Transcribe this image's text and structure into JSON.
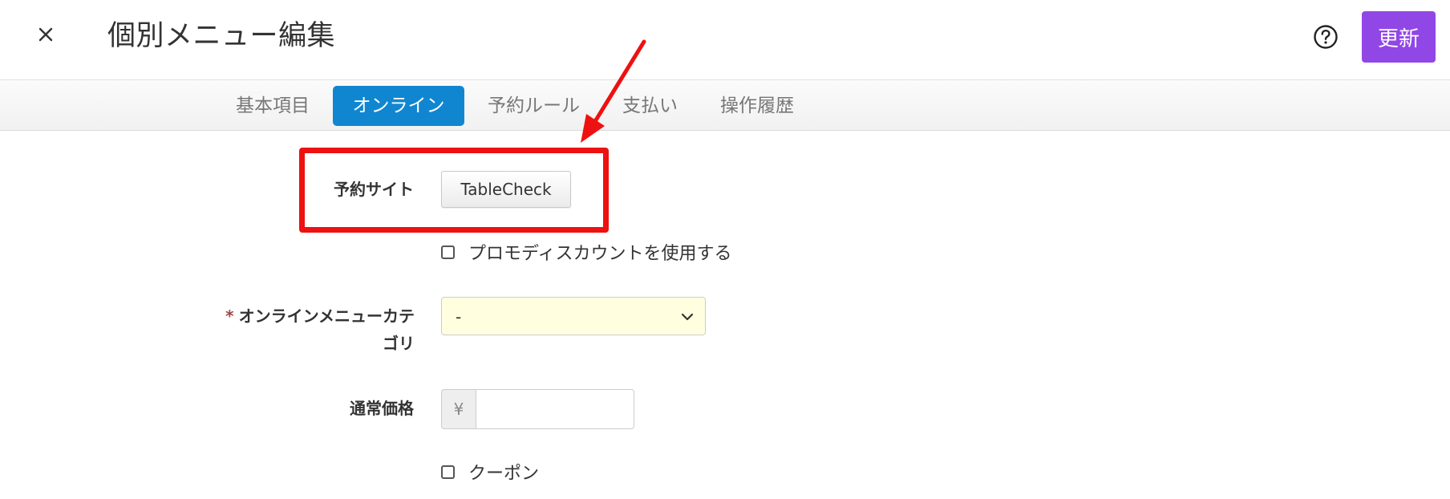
{
  "header": {
    "title": "個別メニュー編集",
    "update_label": "更新"
  },
  "tabs": [
    {
      "label": "基本項目",
      "active": false
    },
    {
      "label": "オンライン",
      "active": true
    },
    {
      "label": "予約ルール",
      "active": false
    },
    {
      "label": "支払い",
      "active": false
    },
    {
      "label": "操作履歴",
      "active": false
    }
  ],
  "form": {
    "reservation_site": {
      "label": "予約サイト",
      "button_label": "TableCheck"
    },
    "promo_discount": {
      "label": "プロモディスカウントを使用する",
      "checked": false
    },
    "online_category": {
      "required_mark": "*",
      "label_line1": "オンラインメニューカテ",
      "label_line2": "ゴリ",
      "selected_value": "-"
    },
    "regular_price": {
      "label": "通常価格",
      "currency_symbol": "¥",
      "value": ""
    },
    "coupon": {
      "label": "クーポン",
      "checked": false
    }
  },
  "colors": {
    "primary_purple": "#9147e6",
    "active_tab_blue": "#1186d0",
    "annotation_red": "#ee1111",
    "select_bg": "#ffffe0"
  },
  "icons": {
    "close": "close-icon",
    "help": "help-circle-icon",
    "dropdown": "chevron-down-icon"
  }
}
